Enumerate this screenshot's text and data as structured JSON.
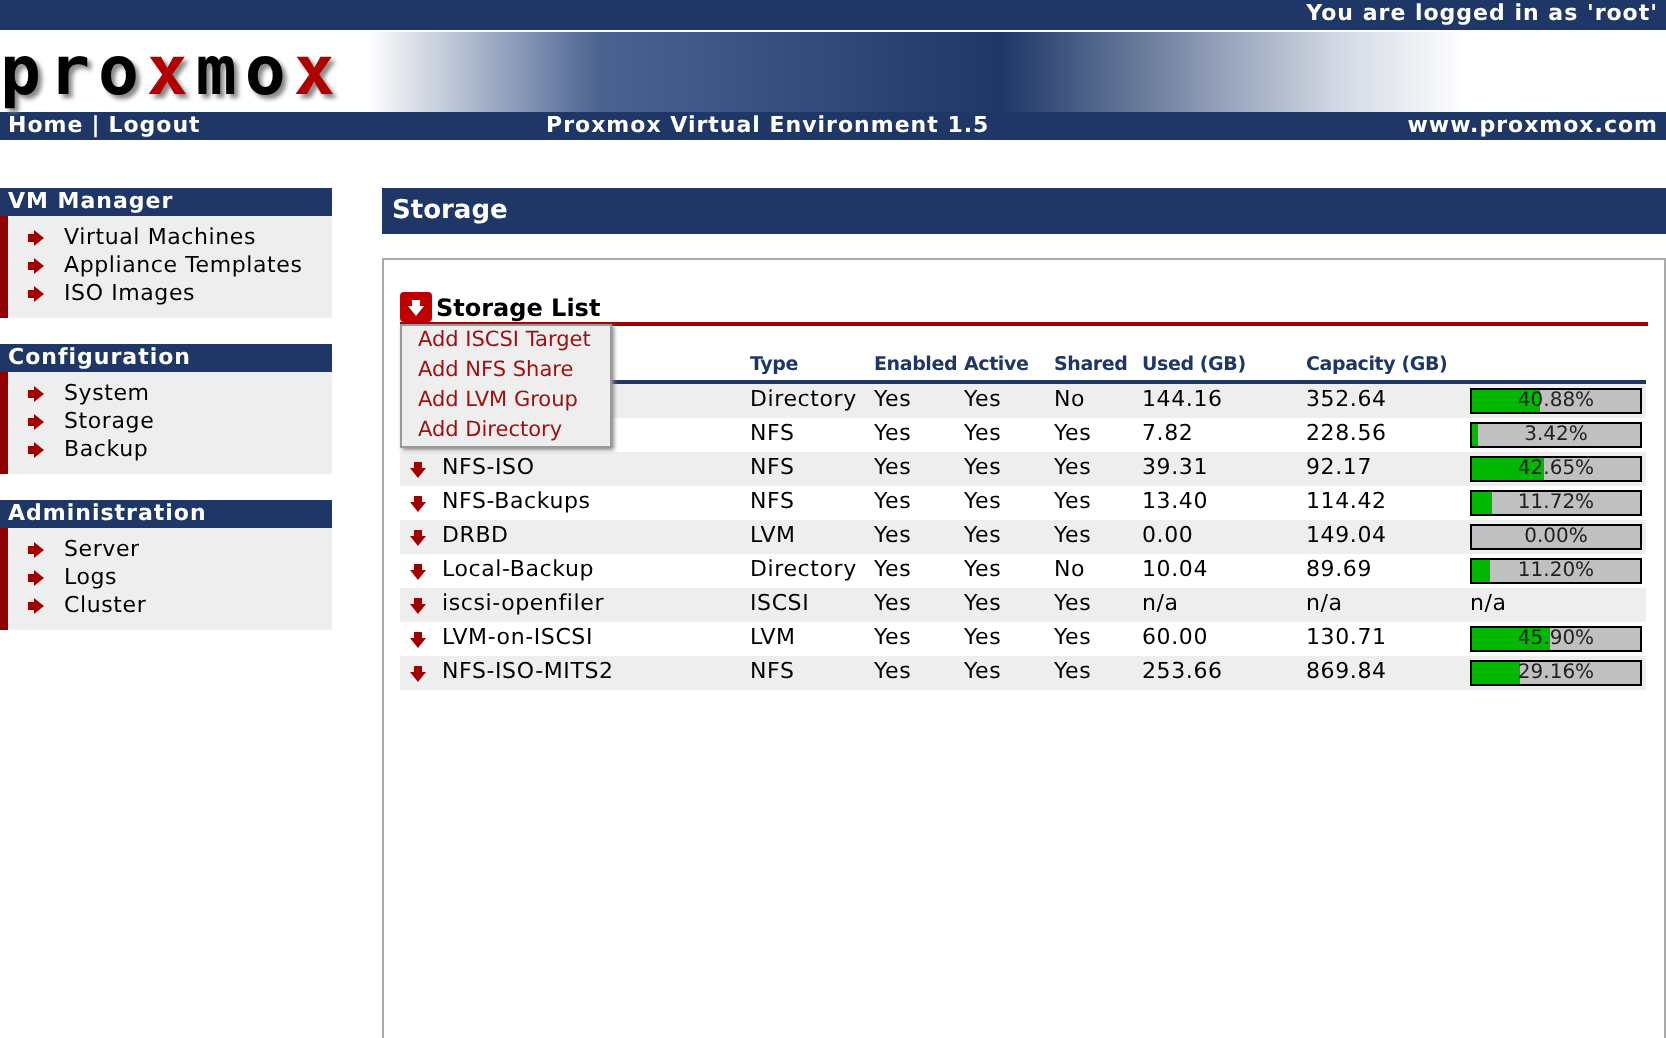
{
  "top_bar": {
    "login_text": "You are logged in as 'root'"
  },
  "logo": [
    {
      "text": "pro",
      "accent": false
    },
    {
      "text": "x",
      "accent": true
    },
    {
      "text": "mo",
      "accent": false
    },
    {
      "text": "x",
      "accent": true
    }
  ],
  "nav_bar": {
    "links": [
      "Home",
      "Logout"
    ],
    "separator": "|",
    "title": "Proxmox Virtual Environment 1.5",
    "site": "www.proxmox.com"
  },
  "sidebar": [
    {
      "title": "VM Manager",
      "items": [
        "Virtual Machines",
        "Appliance Templates",
        "ISO Images"
      ]
    },
    {
      "title": "Configuration",
      "items": [
        "System",
        "Storage",
        "Backup"
      ]
    },
    {
      "title": "Administration",
      "items": [
        "Server",
        "Logs",
        "Cluster"
      ]
    }
  ],
  "page_title": "Storage",
  "storage_list": {
    "title": "Storage List",
    "menu": [
      "Add ISCSI Target",
      "Add NFS Share",
      "Add LVM Group",
      "Add Directory"
    ],
    "columns": [
      "Type",
      "Enabled",
      "Active",
      "Shared",
      "Used (GB)",
      "Capacity (GB)"
    ],
    "rows": [
      {
        "type": "Directory",
        "enabled": "Yes",
        "active": "Yes",
        "shared": "No",
        "used": "144.16",
        "capacity": "352.64",
        "usage": {
          "kind": "bar",
          "level": 0.4088,
          "label": "40.88%"
        }
      },
      {
        "type": "NFS",
        "enabled": "Yes",
        "active": "Yes",
        "shared": "Yes",
        "used": "7.82",
        "capacity": "228.56",
        "usage": {
          "kind": "bar",
          "level": 0.0342,
          "label": "3.42%"
        }
      },
      {
        "name": "NFS-ISO",
        "type": "NFS",
        "enabled": "Yes",
        "active": "Yes",
        "shared": "Yes",
        "used": "39.31",
        "capacity": "92.17",
        "usage": {
          "kind": "bar",
          "level": 0.4265,
          "label": "42.65%"
        }
      },
      {
        "name": "NFS-Backups",
        "type": "NFS",
        "enabled": "Yes",
        "active": "Yes",
        "shared": "Yes",
        "used": "13.40",
        "capacity": "114.42",
        "usage": {
          "kind": "bar",
          "level": 0.1172,
          "label": "11.72%"
        }
      },
      {
        "name": "DRBD",
        "type": "LVM",
        "enabled": "Yes",
        "active": "Yes",
        "shared": "Yes",
        "used": "0.00",
        "capacity": "149.04",
        "usage": {
          "kind": "bar",
          "level": 0,
          "label": "0.00%"
        }
      },
      {
        "name": "Local-Backup",
        "type": "Directory",
        "enabled": "Yes",
        "active": "Yes",
        "shared": "No",
        "used": "10.04",
        "capacity": "89.69",
        "usage": {
          "kind": "bar",
          "level": 0.112,
          "label": "11.20%"
        }
      },
      {
        "name": "iscsi-openfiler",
        "type": "ISCSI",
        "enabled": "Yes",
        "active": "Yes",
        "shared": "Yes",
        "used": "n/a",
        "capacity": "n/a",
        "usage": {
          "kind": "text",
          "label": "n/a"
        }
      },
      {
        "name": "LVM-on-ISCSI",
        "type": "LVM",
        "enabled": "Yes",
        "active": "Yes",
        "shared": "Yes",
        "used": "60.00",
        "capacity": "130.71",
        "usage": {
          "kind": "bar",
          "level": 0.459,
          "label": "45.90%"
        }
      },
      {
        "name": "NFS-ISO-MITS2",
        "type": "NFS",
        "enabled": "Yes",
        "active": "Yes",
        "shared": "Yes",
        "used": "253.66",
        "capacity": "869.84",
        "usage": {
          "kind": "bar",
          "level": 0.2916,
          "label": "29.16%"
        }
      }
    ]
  }
}
